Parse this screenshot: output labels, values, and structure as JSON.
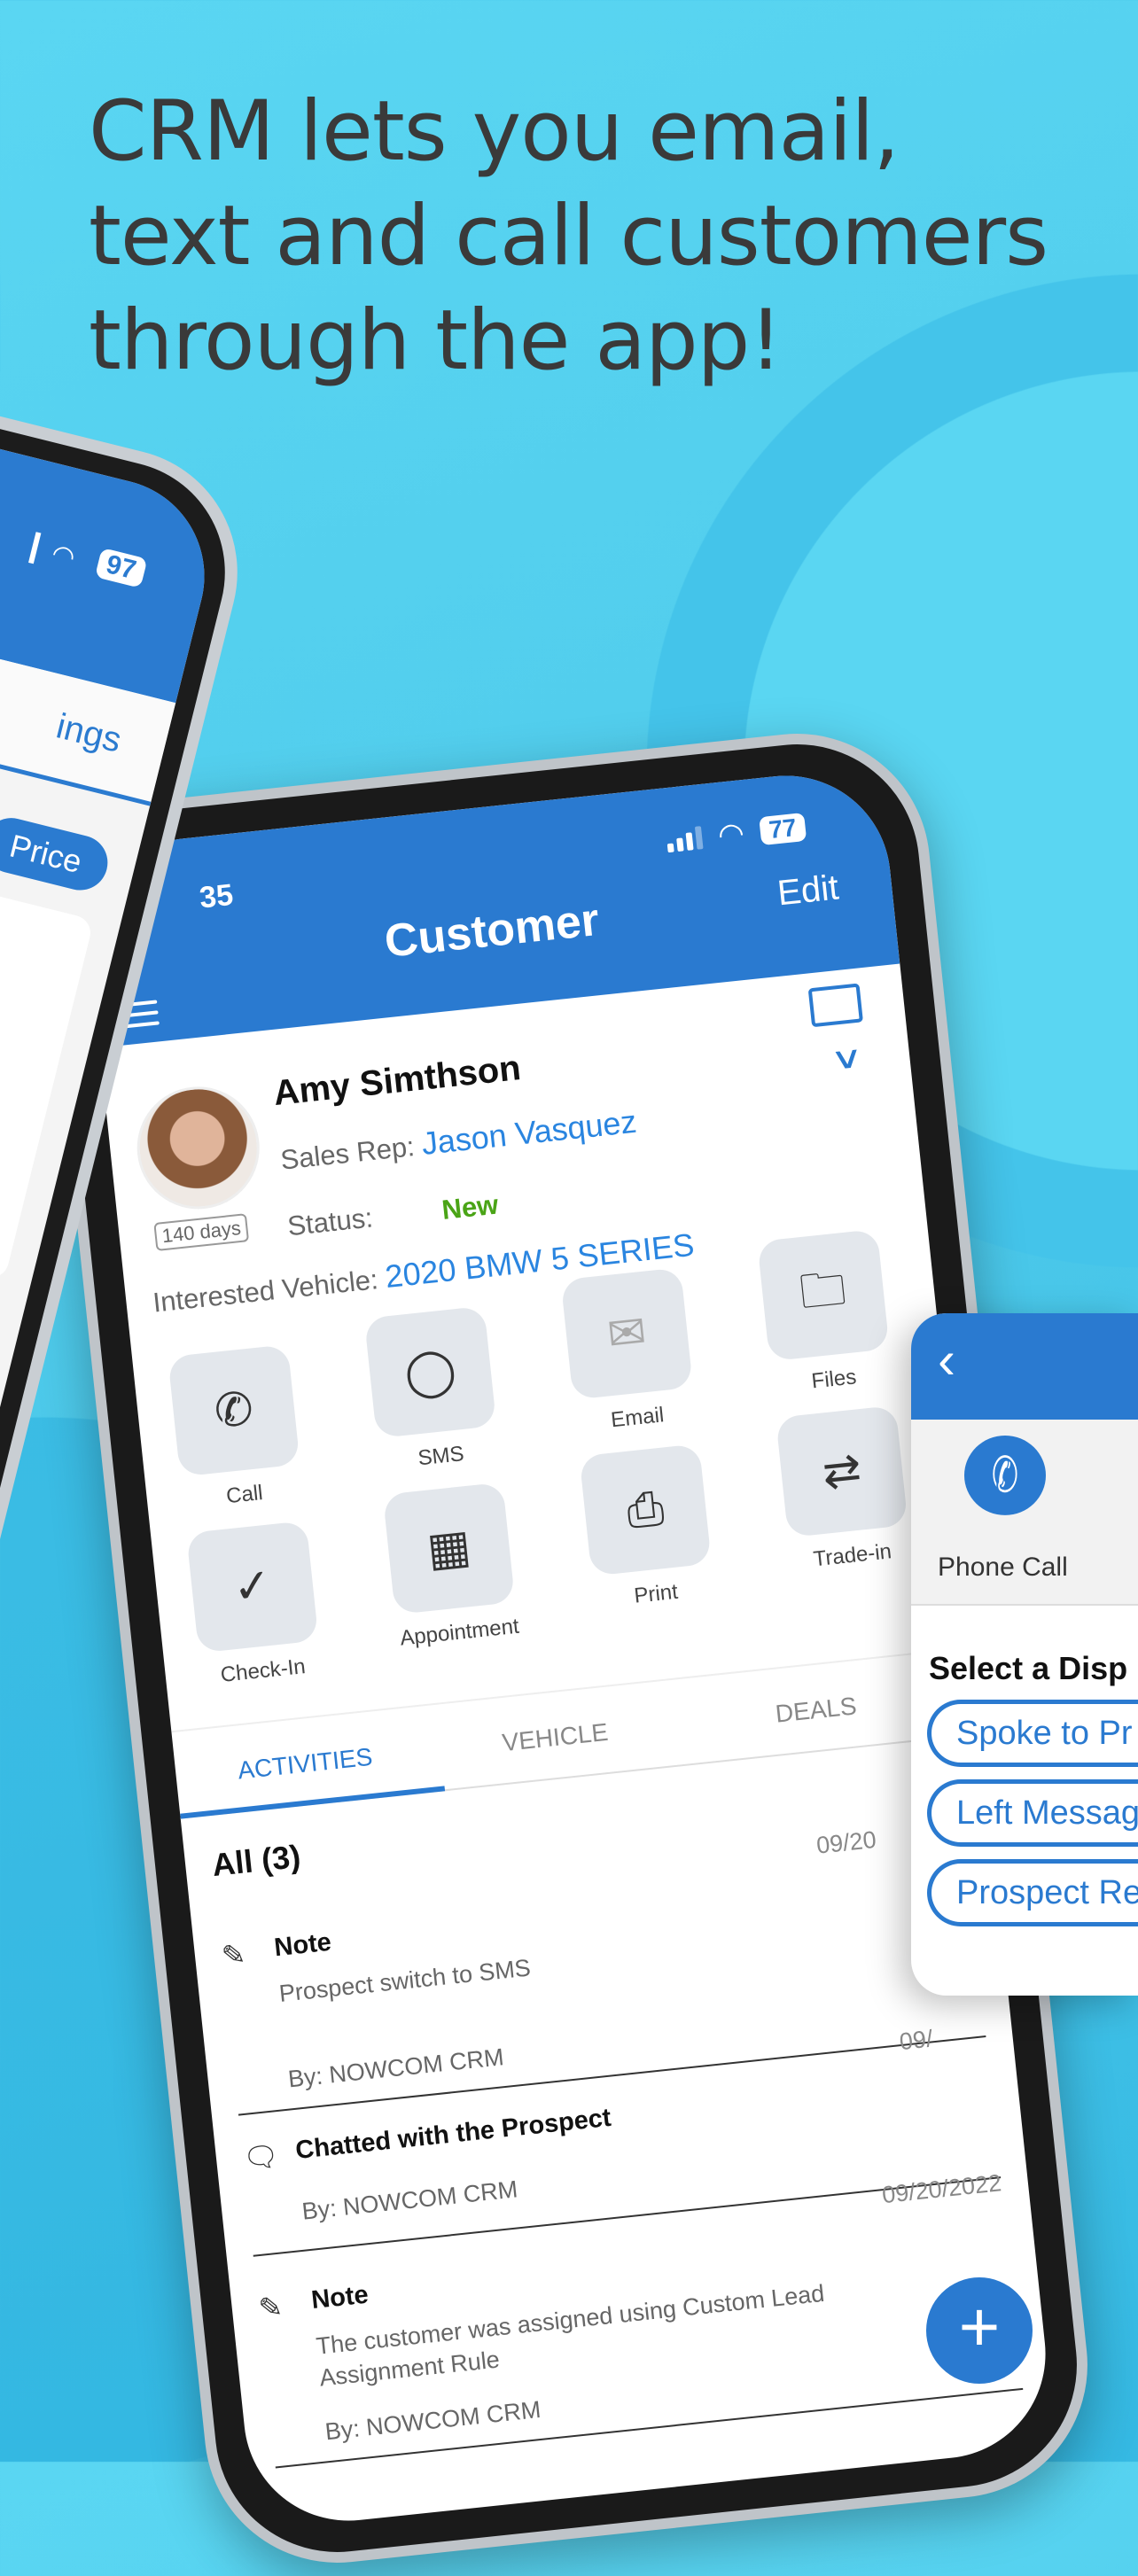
{
  "headline": [
    "CRM lets you email,",
    "text and call customers",
    "through the app!"
  ],
  "left_phone": {
    "battery": "97",
    "tab_partial": "ings",
    "pill_partial": "Price"
  },
  "status_bar": {
    "time": "35",
    "battery": "77"
  },
  "header": {
    "title": "Customer",
    "edit_label": "Edit"
  },
  "customer": {
    "name": "Amy Simthson",
    "days_badge": "140 days",
    "sales_rep_label": "Sales Rep:",
    "sales_rep": "Jason Vasquez",
    "status_label": "Status:",
    "status": "New",
    "vehicle_label": "Interested Vehicle:",
    "vehicle": "2020 BMW 5 SERIES",
    "status_color": "#4aa416",
    "accent": "#2a7ad0"
  },
  "actions": [
    {
      "label": "Call",
      "icon": "phone-icon"
    },
    {
      "label": "SMS",
      "icon": "chat-bubble-icon"
    },
    {
      "label": "Email",
      "icon": "envelope-icon"
    },
    {
      "label": "Files",
      "icon": "folder-icon"
    },
    {
      "label": "Check-In",
      "icon": "location-check-icon"
    },
    {
      "label": "Appointment",
      "icon": "calendar-icon"
    },
    {
      "label": "Print",
      "icon": "printer-icon"
    },
    {
      "label": "Trade-in",
      "icon": "swap-arrows-icon"
    }
  ],
  "tabs": [
    {
      "label": "ACTIVITIES",
      "active": true
    },
    {
      "label": "VEHICLE",
      "active": false
    },
    {
      "label": "DEALS",
      "active": false
    }
  ],
  "activities": {
    "filter_label": "All (3)",
    "items": [
      {
        "type": "Note",
        "description": "Prospect switch to SMS",
        "by": "By: NOWCOM CRM",
        "date": "09/20"
      },
      {
        "type": "Chatted with the Prospect",
        "description": "",
        "by": "By: NOWCOM CRM",
        "date": "09/"
      },
      {
        "type": "Note",
        "description": "The customer was assigned using Custom Lead Assignment Rule",
        "by": "By: NOWCOM CRM",
        "date": "09/20/2022"
      }
    ]
  },
  "popup": {
    "call_label": "Phone Call",
    "select_label": "Select a Disp",
    "options": [
      "Spoke to Pr",
      "Left Messag",
      "Prospect Re"
    ]
  }
}
